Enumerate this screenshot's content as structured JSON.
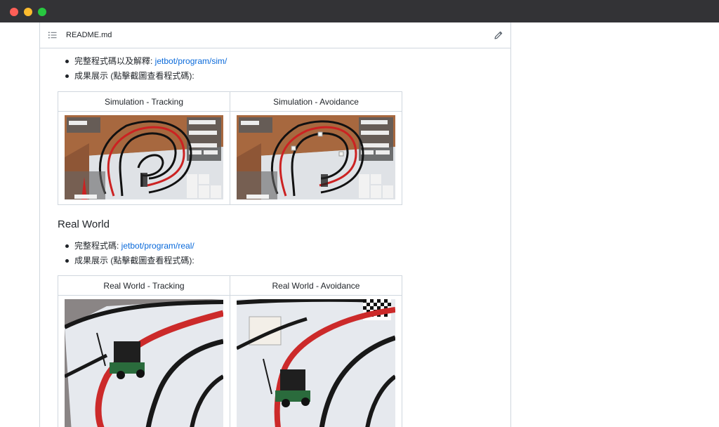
{
  "window": {
    "controls": [
      "close",
      "minimize",
      "maximize"
    ]
  },
  "readme": {
    "filename": "README.md",
    "header_icon": "list-unordered-icon",
    "edit_icon": "pencil-icon"
  },
  "sim_section": {
    "bullets": [
      {
        "text": "完整程式碼以及解釋: ",
        "link": "jetbot/program/sim/"
      },
      {
        "text": "成果展示 (點擊截圖查看程式碼):",
        "link": ""
      }
    ],
    "table_headers": [
      "Simulation - Tracking",
      "Simulation - Avoidance"
    ],
    "images": [
      "simulation-tracking-screenshot",
      "simulation-avoidance-screenshot"
    ]
  },
  "real_section": {
    "heading": "Real World",
    "bullets": [
      {
        "text": "完整程式碼: ",
        "link": "jetbot/program/real/"
      },
      {
        "text": "成果展示 (點擊截圖查看程式碼):",
        "link": ""
      }
    ],
    "table_headers": [
      "Real World - Tracking",
      "Real World - Avoidance"
    ],
    "images": [
      "real-world-tracking-photo",
      "real-world-avoidance-photo"
    ]
  },
  "colors": {
    "titlebar": "#333336",
    "link": "#0969da",
    "border": "#d0d7de",
    "text": "#1f2328"
  }
}
